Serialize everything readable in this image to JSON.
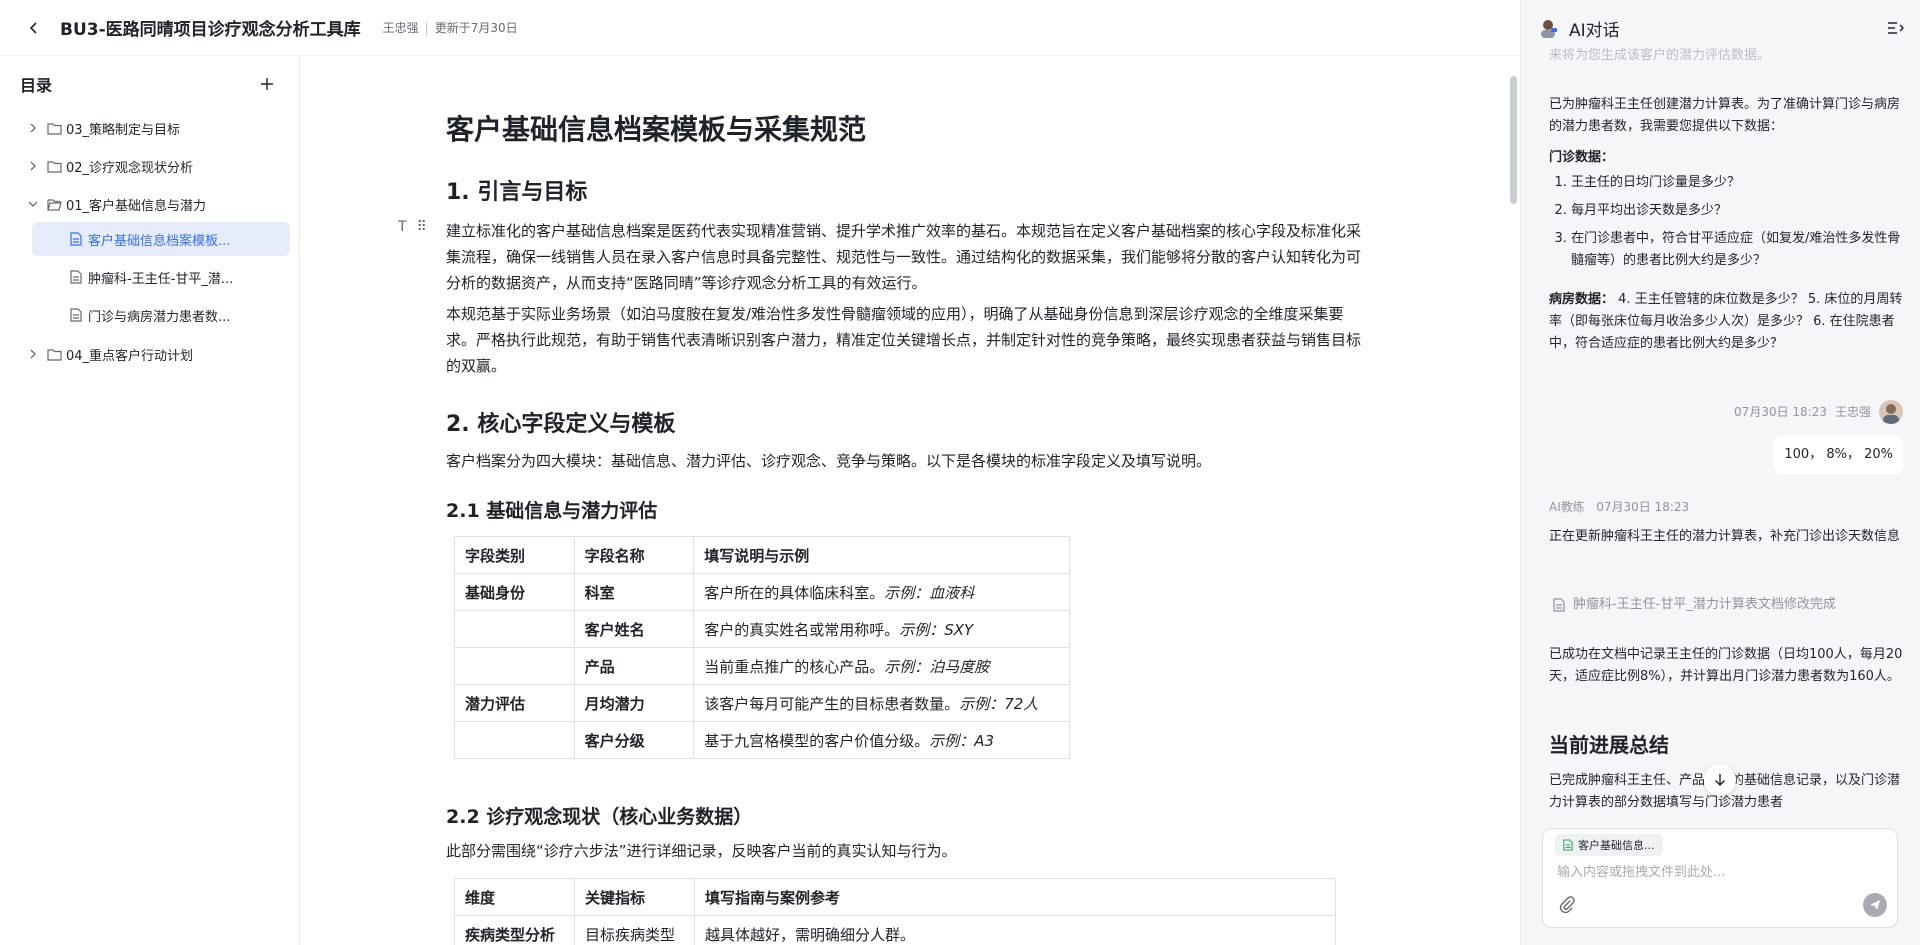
{
  "header": {
    "title": "BU3-医路同晴项目诊疗观念分析工具库",
    "author": "王忠强",
    "updated": "更新于7月30日"
  },
  "sidebar": {
    "title": "目录",
    "items": [
      {
        "label": "03_策略制定与目标"
      },
      {
        "label": "02_诊疗观念现状分析"
      },
      {
        "label": "01_客户基础信息与潜力"
      },
      {
        "label": "客户基础信息档案模板..."
      },
      {
        "label": "肿瘤科-王主任-甘平_潜..."
      },
      {
        "label": "门诊与病房潜力患者数..."
      },
      {
        "label": "04_重点客户行动计划"
      }
    ]
  },
  "doc": {
    "h1": "客户基础信息档案模板与采集规范",
    "s1_title": "1. 引言与目标",
    "p1": "建立标准化的客户基础信息档案是医药代表实现精准营销、提升学术推广效率的基石。本规范旨在定义客户基础档案的核心字段及标准化采集流程，确保一线销售人员在录入客户信息时具备完整性、规范性与一致性。通过结构化的数据采集，我们能够将分散的客户认知转化为可分析的数据资产，从而支持“医路同晴”等诊疗观念分析工具的有效运行。",
    "p2": "本规范基于实际业务场景（如泊马度胺在复发/难治性多发性骨髓瘤领域的应用），明确了从基础身份信息到深层诊疗观念的全维度采集要求。严格执行此规范，有助于销售代表清晰识别客户潜力，精准定位关键增长点，并制定针对性的竞争策略，最终实现患者获益与销售目标的双赢。",
    "s2_title": "2. 核心字段定义与模板",
    "p3": "客户档案分为四大模块：基础信息、潜力评估、诊疗观念、竞争与策略。以下是各模块的标准字段定义及填写说明。",
    "s21_title": "2.1 基础信息与潜力评估",
    "table1": {
      "headers": [
        "字段类别",
        "字段名称",
        "填写说明与示例"
      ],
      "rows": [
        {
          "cat": "基础身份",
          "name": "科室",
          "desc": "客户所在的具体临床科室。",
          "ex": "示例：血液科"
        },
        {
          "cat": "",
          "name": "客户姓名",
          "desc": "客户的真实姓名或常用称呼。",
          "ex": "示例：SXY"
        },
        {
          "cat": "",
          "name": "产品",
          "desc": "当前重点推广的核心产品。",
          "ex": "示例：泊马度胺"
        },
        {
          "cat": "潜力评估",
          "name": "月均潜力",
          "desc": "该客户每月可能产生的目标患者数量。",
          "ex": "示例：72人"
        },
        {
          "cat": "",
          "name": "客户分级",
          "desc": "基于九宫格模型的客户价值分级。",
          "ex": "示例：A3"
        }
      ]
    },
    "s22_title": "2.2 诊疗观念现状（核心业务数据）",
    "p4": "此部分需围绕“诊疗六步法”进行详细记录，反映客户当前的真实认知与行为。",
    "table2": {
      "headers": [
        "维度",
        "关键指标",
        "填写指南与案例参考"
      ],
      "rows": [
        {
          "dim": "疾病类型分析",
          "kpi": "目标疾病类型",
          "guide": "越具体越好，需明确细分人群。"
        }
      ]
    }
  },
  "panel": {
    "title": "AI对话",
    "faded_top": "来将为您生成该客户的潜力评估数据。",
    "ai_msg1": "已为肿瘤科王主任创建潜力计算表。为了准确计算门诊与病房的潜力患者数，我需要您提供以下数据：",
    "outpatient_label": "门诊数据：",
    "questions": [
      "王主任的日均门诊量是多少？",
      "每月平均出诊天数是多少？",
      "在门诊患者中，符合甘平适应症（如复发/难治性多发性骨髓瘤等）的患者比例大约是多少？"
    ],
    "ward_label": "病房数据：",
    "ward_text": "4. 王主任管辖的床位数是多少？ 5. 床位的月周转率（即每张床位每月收治多少人次）是多少？ 6. 在住院患者中，符合适应症的患者比例大约是多少？",
    "user_time": "07月30日 18:23",
    "user_name": "王忠强",
    "user_msg": "100， 8%， 20%",
    "ai_name": "AI教练",
    "ai_time": "07月30日 18:23",
    "ai_msg2": "正在更新肿瘤科王主任的潜力计算表，补充门诊出诊天数信息",
    "file_ref": "肿瘤科-王主任-甘平_潜力计算表文档修改完成",
    "ai_msg3": "已成功在文档中记录王主任的门诊数据（日均100人，每月20天，适应症比例8%），并计算出月门诊潜力患者数为160人。",
    "summary_title": "当前进展总结",
    "summary_text": "已完成肿瘤科王主任、产品甘平的基础信息记录，以及门诊潜力计算表的部分数据填写与门诊潜力患者",
    "composer": {
      "chip": "客户基础信息...",
      "placeholder": "输入内容或拖拽文件到此处..."
    }
  }
}
